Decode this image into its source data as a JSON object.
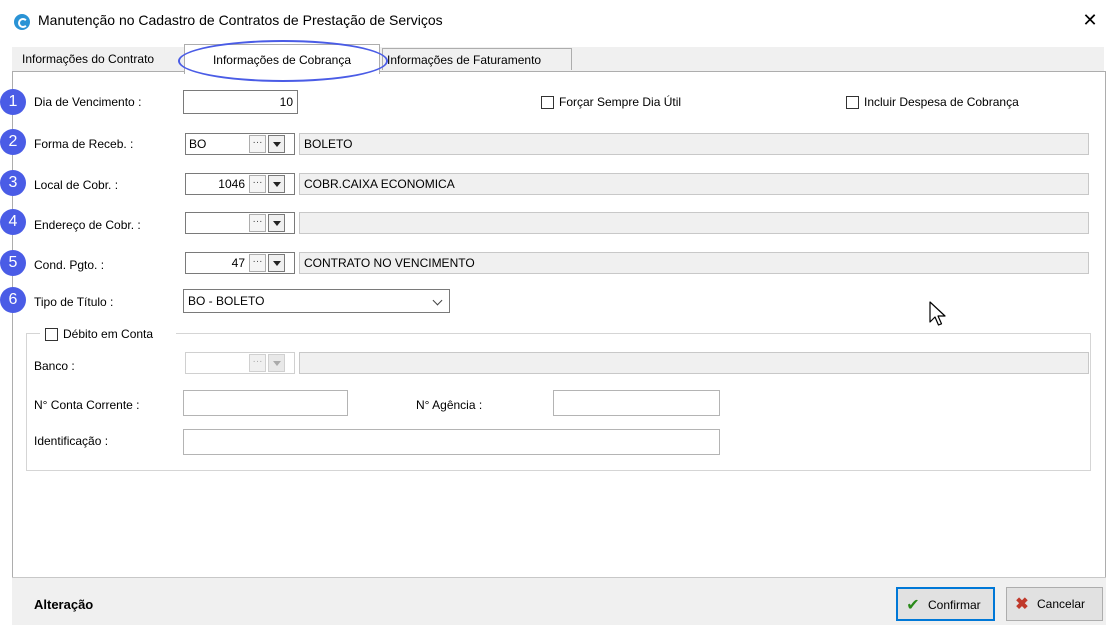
{
  "window": {
    "title": "Manutenção no Cadastro de Contratos de Prestação de Serviços",
    "close_glyph": "✕"
  },
  "tabs": [
    {
      "label": "Informações do Contrato",
      "active": false
    },
    {
      "label": "Informações de Cobrança",
      "active": true
    },
    {
      "label": "Informações de Faturamento",
      "active": false
    }
  ],
  "markers": [
    "1",
    "2",
    "3",
    "4",
    "5",
    "6"
  ],
  "form": {
    "vencimento": {
      "label": "Dia de Vencimento :",
      "value": "10"
    },
    "forcar_dia_util": {
      "label": "Forçar Sempre Dia Útil",
      "checked": false
    },
    "incluir_despesa": {
      "label": "Incluir Despesa de Cobrança",
      "checked": false
    },
    "forma_receb": {
      "label": "Forma de Receb. :",
      "code": "BO",
      "description": "BOLETO"
    },
    "local_cobr": {
      "label": "Local de Cobr. :",
      "code": "1046",
      "description": "COBR.CAIXA ECONOMICA"
    },
    "endereco_cobr": {
      "label": "Endereço de Cobr. :",
      "code": "",
      "description": ""
    },
    "cond_pgto": {
      "label": "Cond. Pgto. :",
      "code": "47",
      "description": "CONTRATO NO VENCIMENTO"
    },
    "tipo_titulo": {
      "label": "Tipo de Título :",
      "value": "BO - BOLETO"
    },
    "ellipsis_glyph": "···"
  },
  "debito": {
    "label": "Débito em Conta",
    "checked": false,
    "banco": {
      "label": "Banco :",
      "code": "",
      "description": ""
    },
    "conta_corrente": {
      "label": "N° Conta Corrente :",
      "value": ""
    },
    "agencia": {
      "label": "N° Agência :",
      "value": ""
    },
    "identificacao": {
      "label": "Identificação :",
      "value": ""
    }
  },
  "footer": {
    "status": "Alteração",
    "confirm_label": "Confirmar",
    "cancel_label": "Cancelar",
    "confirm_icon": "check-icon",
    "cancel_icon": "x-icon"
  },
  "colors": {
    "marker": "#4a5ce6",
    "focus_border": "#0078d7",
    "confirm_check": "#2a8a1a",
    "cancel_x": "#c0392b"
  }
}
